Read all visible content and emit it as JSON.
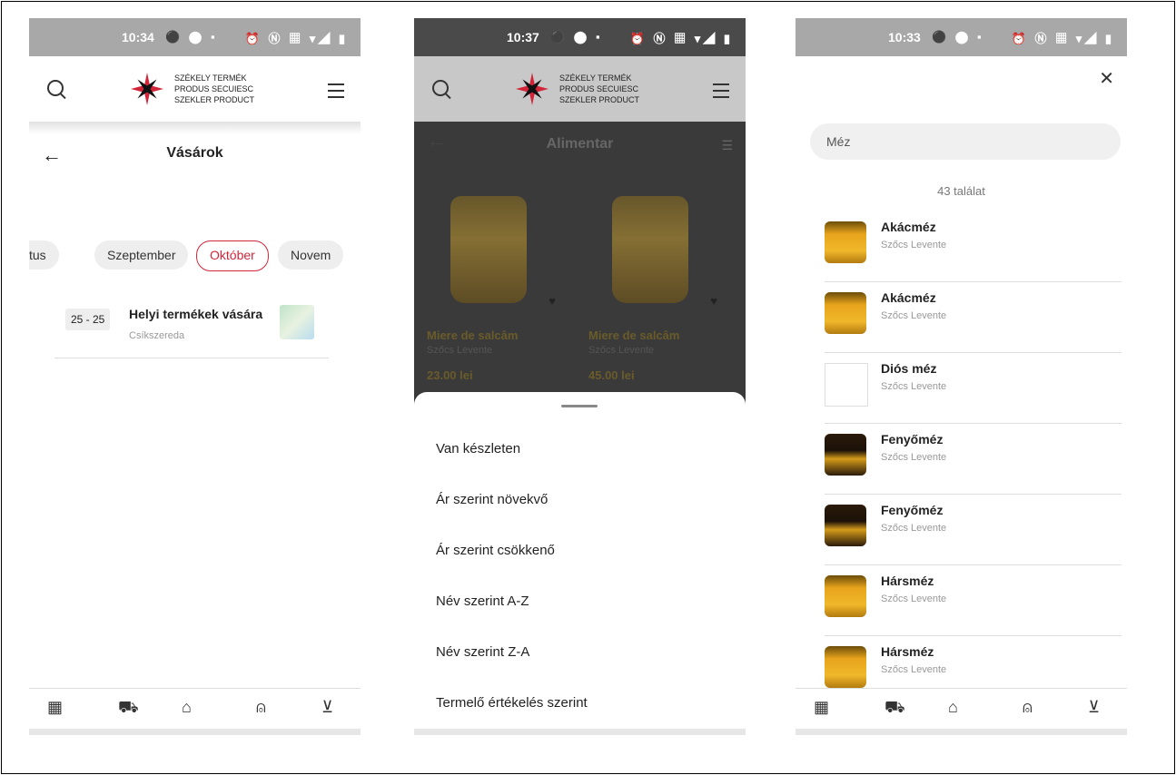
{
  "screens": {
    "markets": {
      "status": {
        "time": "10:34",
        "left_icons": "⚫ ⬤ ▪",
        "right_icons": "⏰ Ⓝ ▦ ▾◢ ▮"
      },
      "logo": {
        "line1": "SZÉKELY TERMÉK",
        "line2": "PRODUS SECUIESC",
        "line3": "SZEKLER PRODUCT"
      },
      "title": "Vásárok",
      "months": [
        "tus",
        "Szeptember",
        "Október",
        "Novem"
      ],
      "active_month": "Október",
      "events": [
        {
          "date": "25 - 25",
          "title": "Helyi termékek vására",
          "city": "Csíkszereda"
        }
      ]
    },
    "category": {
      "status": {
        "time": "10:37",
        "left_icons": "⚫ ⬤ ▪",
        "right_icons": "⏰ Ⓝ ▦ ▾◢ ▮"
      },
      "logo": {
        "line1": "SZÉKELY TERMÉK",
        "line2": "PRODUS SECUIESC",
        "line3": "SZEKLER PRODUCT"
      },
      "title": "Alimentar",
      "products": [
        {
          "name": "Miere de salcâm",
          "producer": "Szőcs Levente",
          "price": "23.00 lei"
        },
        {
          "name": "Miere de salcâm",
          "producer": "Szőcs Levente",
          "price": "45.00 lei"
        }
      ],
      "sort_options": [
        "Van készleten",
        "Ár szerint növekvő",
        "Ár szerint csökkenő",
        "Név szerint A-Z",
        "Név szerint Z-A",
        "Termelő értékelés szerint"
      ]
    },
    "search": {
      "status": {
        "time": "10:33",
        "left_icons": "⚫ ⬤ ▪",
        "right_icons": "⏰ Ⓝ ▦ ▾◢ ▮"
      },
      "query": "Méz",
      "result_count": "43 találat",
      "results": [
        {
          "name": "Akácméz",
          "producer": "Szőcs Levente"
        },
        {
          "name": "Akácméz",
          "producer": "Szőcs Levente"
        },
        {
          "name": "Diós méz",
          "producer": "Szőcs Levente"
        },
        {
          "name": "Fenyőméz",
          "producer": "Szőcs Levente"
        },
        {
          "name": "Fenyőméz",
          "producer": "Szőcs Levente"
        },
        {
          "name": "Hársméz",
          "producer": "Szőcs Levente"
        },
        {
          "name": "Hársméz",
          "producer": "Szőcs Levente"
        }
      ]
    }
  },
  "nav_icons": [
    "grid-icon",
    "truck-icon",
    "store-icon",
    "user-icon",
    "cart-icon"
  ],
  "colors": {
    "accent": "#d3253a",
    "statusbar": "#a8a8a8",
    "overlay": "#3a3a3a"
  }
}
